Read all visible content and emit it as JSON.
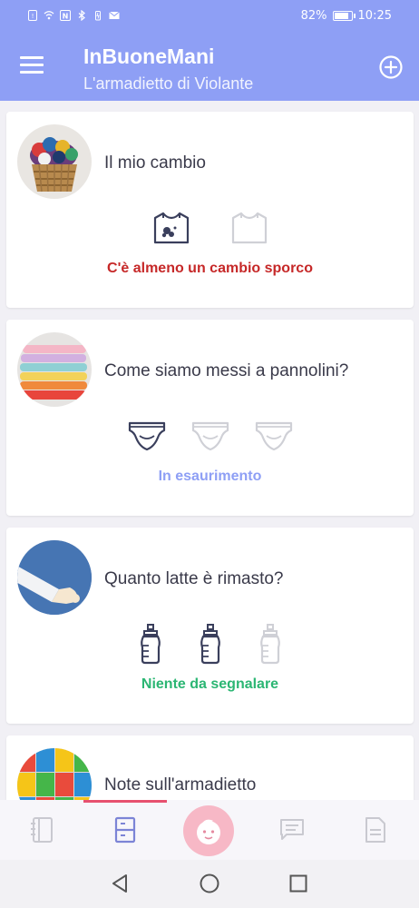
{
  "status_bar": {
    "battery": "82%",
    "time": "10:25"
  },
  "header": {
    "title": "InBuoneMani",
    "subtitle": "L'armadietto di Violante"
  },
  "cards": [
    {
      "title": "Il mio cambio",
      "status": "C'è almeno un cambio sporco",
      "status_color": "#c62828",
      "icons": [
        "tshirt-dirty-icon",
        "tshirt-empty-icon"
      ],
      "level": "1 of 2 dirty"
    },
    {
      "title": "Come siamo messi a pannolini?",
      "status": "In esaurimento",
      "status_color": "#8e9ff5",
      "icons": [
        "diaper-full-icon",
        "diaper-empty-icon",
        "diaper-empty-icon"
      ],
      "level": "1 of 3"
    },
    {
      "title": "Quanto latte è rimasto?",
      "status": "Niente da segnalare",
      "status_color": "#2bb673",
      "icons": [
        "bottle-full-icon",
        "bottle-full-icon",
        "bottle-empty-icon"
      ],
      "level": "2 of 3"
    },
    {
      "title": "Note sull'armadietto"
    }
  ],
  "bottom_nav": {
    "items": [
      "notebook-icon",
      "locker-icon",
      "baby-face-icon",
      "chat-icon",
      "document-icon"
    ],
    "active": "locker-icon"
  },
  "colors": {
    "primary": "#8e9ff5",
    "accent": "#e7516f",
    "icon_dark": "#3a3f5c",
    "icon_light": "#cfd0d6"
  }
}
